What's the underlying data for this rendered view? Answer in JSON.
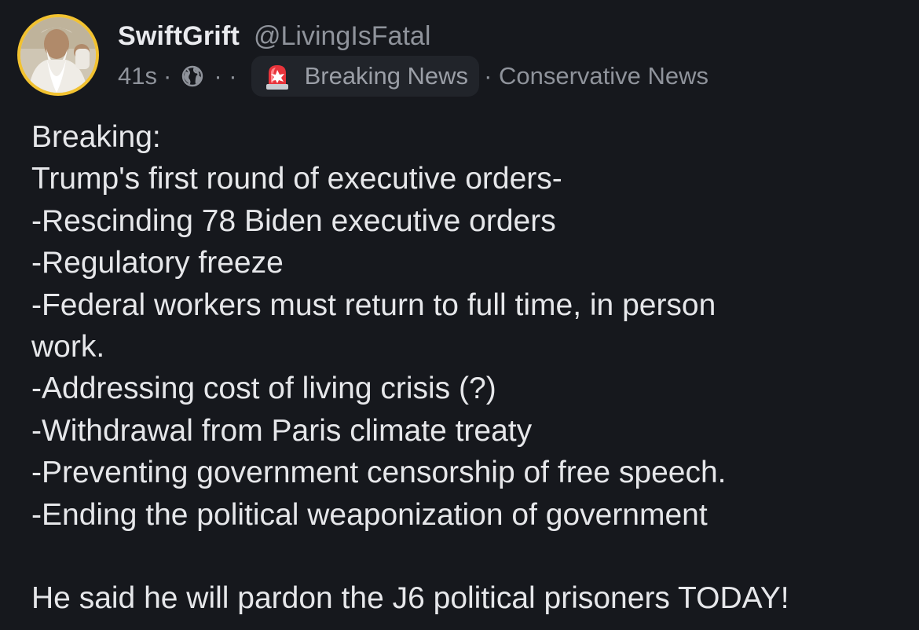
{
  "author": {
    "display_name": "SwiftGrift",
    "handle": "@LivingIsFatal"
  },
  "meta": {
    "time": "41s",
    "dot": "·",
    "ellipsis_dots": "· ·",
    "visibility_icon": "globe-icon",
    "group_icon": "siren-icon",
    "group_name": "Breaking News",
    "category": "· Conservative News"
  },
  "colors": {
    "background": "#16181d",
    "avatar_ring": "#f2c230",
    "text_primary": "#e6e7ea",
    "text_secondary": "#8f939b",
    "badge_bg": "#21242a"
  },
  "post": {
    "lines": [
      "Breaking:",
      "Trump's first round of executive orders-",
      "-Rescinding 78 Biden executive orders",
      "-Regulatory freeze",
      "-Federal workers must return to full time, in person",
      "work.",
      "-Addressing cost of living crisis (?)",
      "-Withdrawal from Paris climate treaty",
      "-Preventing government censorship of free speech.",
      "-Ending the political weaponization of government",
      "",
      "He said he will pardon the J6 political prisoners TODAY!"
    ]
  }
}
